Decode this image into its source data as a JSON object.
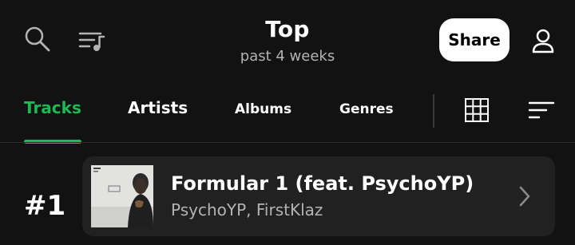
{
  "header": {
    "title": "Top",
    "subtitle": "past 4 weeks",
    "share_label": "Share",
    "icons": [
      "search-icon",
      "queue-music-icon",
      "profile-icon"
    ]
  },
  "tabs": [
    {
      "label": "Tracks",
      "active": true
    },
    {
      "label": "Artists",
      "active": false
    },
    {
      "label": "Albums",
      "active": false
    },
    {
      "label": "Genres",
      "active": false
    }
  ],
  "view_controls": [
    "grid-view-icon",
    "sort-icon"
  ],
  "tracks": [
    {
      "rank": "#1",
      "title": "Formular 1 (feat. PsychoYP)",
      "artists": "PsychoYP, FirstKlaz"
    }
  ],
  "colors": {
    "background": "#121212",
    "accent": "#1db954",
    "card": "#212121",
    "secondary_text": "#b3b3b3"
  }
}
